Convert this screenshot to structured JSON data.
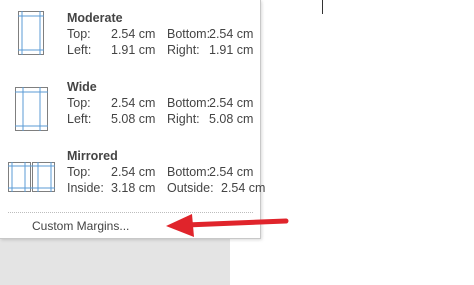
{
  "menu": {
    "items": [
      {
        "name": "Moderate",
        "rows": [
          {
            "l1": "Top:",
            "v1": "2.54 cm",
            "l2": "Bottom:",
            "v2": "2.54 cm"
          },
          {
            "l1": "Left:",
            "v1": "1.91 cm",
            "l2": "Right:",
            "v2": "1.91 cm"
          }
        ]
      },
      {
        "name": "Wide",
        "rows": [
          {
            "l1": "Top:",
            "v1": "2.54 cm",
            "l2": "Bottom:",
            "v2": "2.54 cm"
          },
          {
            "l1": "Left:",
            "v1": "5.08 cm",
            "l2": "Right:",
            "v2": "5.08 cm"
          }
        ]
      },
      {
        "name": "Mirrored",
        "rows": [
          {
            "l1": "Top:",
            "v1": "2.54 cm",
            "l2": "Bottom:",
            "v2": "2.54 cm"
          },
          {
            "l1": "Inside:",
            "v1": "3.18 cm",
            "l2": "Outside:",
            "v2": "2.54 cm"
          }
        ]
      }
    ],
    "custom_label": "Custom Margins..."
  },
  "colors": {
    "arrow": "#e0242b",
    "icon_line": "#5b9bd5",
    "page_border": "#7f7f7f"
  }
}
